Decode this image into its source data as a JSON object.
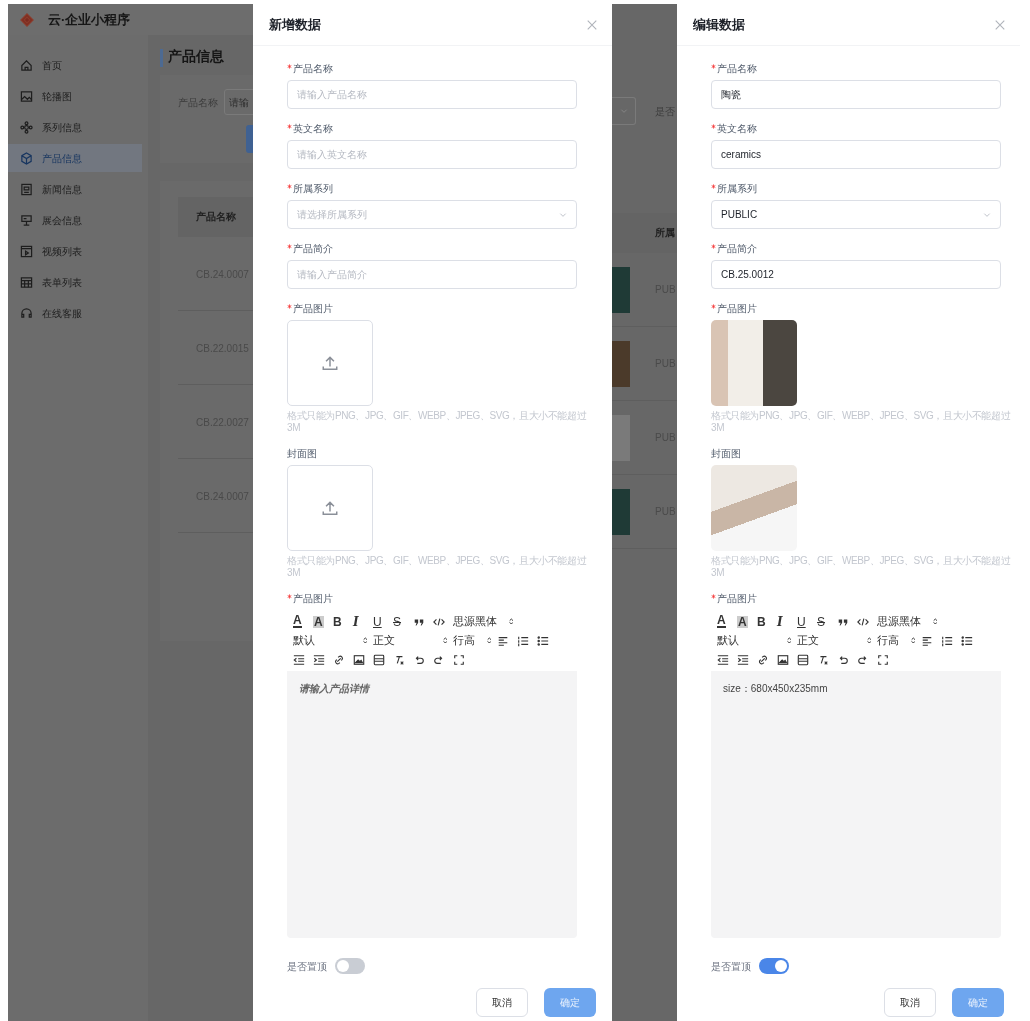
{
  "app": {
    "title": "云·企业小程序",
    "sidebar": [
      {
        "label": "首页",
        "selected": false
      },
      {
        "label": "轮播图",
        "selected": false
      },
      {
        "label": "系列信息",
        "selected": false
      },
      {
        "label": "产品信息",
        "selected": true
      },
      {
        "label": "新闻信息",
        "selected": false
      },
      {
        "label": "展会信息",
        "selected": false
      },
      {
        "label": "视频列表",
        "selected": false
      },
      {
        "label": "表单列表",
        "selected": false
      },
      {
        "label": "在线客服",
        "selected": false
      }
    ],
    "page_title": "产品信息",
    "filter": {
      "label": "产品名称",
      "placeholder": "请输"
    },
    "table": {
      "columns": [
        "产品名称"
      ],
      "rows": [
        [
          "CB.24.0007"
        ],
        [
          "CB.22.0015"
        ],
        [
          "CB.22.0027"
        ],
        [
          "CB.24.0007"
        ]
      ]
    },
    "strip": {
      "filter_label": "是否",
      "column": "所属",
      "rows": [
        "PUB",
        "PUB",
        "PUB",
        "PUB"
      ]
    }
  },
  "dialogs": [
    {
      "title": "新增数据",
      "fields": [
        {
          "kind": "input",
          "label": "产品名称",
          "required": true,
          "placeholder": "请输入产品名称"
        },
        {
          "kind": "input",
          "label": "英文名称",
          "required": true,
          "placeholder": "请输入英文名称"
        },
        {
          "kind": "select",
          "label": "所属系列",
          "required": true,
          "placeholder": "请选择所属系列"
        },
        {
          "kind": "input",
          "label": "产品简介",
          "required": true,
          "placeholder": "请输入产品简介"
        },
        {
          "kind": "upload",
          "label": "产品图片",
          "required": true,
          "image": false,
          "hint": "格式只能为PNG、JPG、GIF、WEBP、JPEG、SVG，且大小不能超过3M"
        },
        {
          "kind": "upload",
          "label": "封面图",
          "required": false,
          "image": false,
          "hint": "格式只能为PNG、JPG、GIF、WEBP、JPEG、SVG，且大小不能超过3M"
        },
        {
          "kind": "editor",
          "label": "产品图片",
          "required": true,
          "placeholder": "请输入产品详情",
          "toolbar": [
            {
              "kind": "color",
              "text": "A"
            },
            {
              "kind": "highlight",
              "text": "A"
            },
            {
              "kind": "bold",
              "text": "B"
            },
            {
              "kind": "italic",
              "text": "I"
            },
            {
              "kind": "underline",
              "text": "U"
            },
            {
              "kind": "strike",
              "text": "S"
            },
            {
              "kind": "icon"
            },
            {
              "kind": "icon"
            },
            {
              "kind": "select",
              "text": "思源黑体"
            },
            {
              "kind": "select",
              "text": "默认"
            },
            {
              "kind": "select",
              "text": "正文"
            },
            {
              "kind": "select",
              "text": "行高"
            },
            {
              "kind": "icon"
            },
            {
              "kind": "icon"
            },
            {
              "kind": "icon"
            },
            {
              "kind": "icon"
            },
            {
              "kind": "icon"
            },
            {
              "kind": "icon"
            },
            {
              "kind": "icon"
            },
            {
              "kind": "icon"
            },
            {
              "kind": "icon"
            },
            {
              "kind": "icon"
            },
            {
              "kind": "icon"
            },
            {
              "kind": "icon"
            }
          ]
        },
        {
          "kind": "switch",
          "label": "是否置顶",
          "on": false
        }
      ],
      "buttons": [
        {
          "label": "取消",
          "kind": "default"
        },
        {
          "label": "确定",
          "kind": "primary"
        }
      ]
    },
    {
      "title": "编辑数据",
      "fields": [
        {
          "kind": "input",
          "label": "产品名称",
          "required": true,
          "value": "陶瓷"
        },
        {
          "kind": "input",
          "label": "英文名称",
          "required": true,
          "value": "ceramics"
        },
        {
          "kind": "select",
          "label": "所属系列",
          "required": true,
          "value": "PUBLIC"
        },
        {
          "kind": "input",
          "label": "产品简介",
          "required": true,
          "value": "CB.25.0012"
        },
        {
          "kind": "upload",
          "label": "产品图片",
          "required": true,
          "image": true,
          "hint": "格式只能为PNG、JPG、GIF、WEBP、JPEG、SVG，且大小不能超过3M"
        },
        {
          "kind": "upload",
          "label": "封面图",
          "required": false,
          "image": true,
          "hint": "格式只能为PNG、JPG、GIF、WEBP、JPEG、SVG，且大小不能超过3M"
        },
        {
          "kind": "editor",
          "label": "产品图片",
          "required": true,
          "value": "size：680x450x235mm",
          "toolbar": [
            {
              "kind": "color",
              "text": "A"
            },
            {
              "kind": "highlight",
              "text": "A"
            },
            {
              "kind": "bold",
              "text": "B"
            },
            {
              "kind": "italic",
              "text": "I"
            },
            {
              "kind": "underline",
              "text": "U"
            },
            {
              "kind": "strike",
              "text": "S"
            },
            {
              "kind": "icon"
            },
            {
              "kind": "icon"
            },
            {
              "kind": "select",
              "text": "思源黑体"
            },
            {
              "kind": "select",
              "text": "默认"
            },
            {
              "kind": "select",
              "text": "正文"
            },
            {
              "kind": "select",
              "text": "行高"
            },
            {
              "kind": "icon"
            },
            {
              "kind": "icon"
            },
            {
              "kind": "icon"
            },
            {
              "kind": "icon"
            },
            {
              "kind": "icon"
            },
            {
              "kind": "icon"
            },
            {
              "kind": "icon"
            },
            {
              "kind": "icon"
            },
            {
              "kind": "icon"
            },
            {
              "kind": "icon"
            },
            {
              "kind": "icon"
            },
            {
              "kind": "icon"
            }
          ]
        },
        {
          "kind": "switch",
          "label": "是否置顶",
          "on": true
        }
      ],
      "buttons": [
        {
          "label": "取消",
          "kind": "default"
        },
        {
          "label": "确定",
          "kind": "primary"
        }
      ]
    }
  ]
}
